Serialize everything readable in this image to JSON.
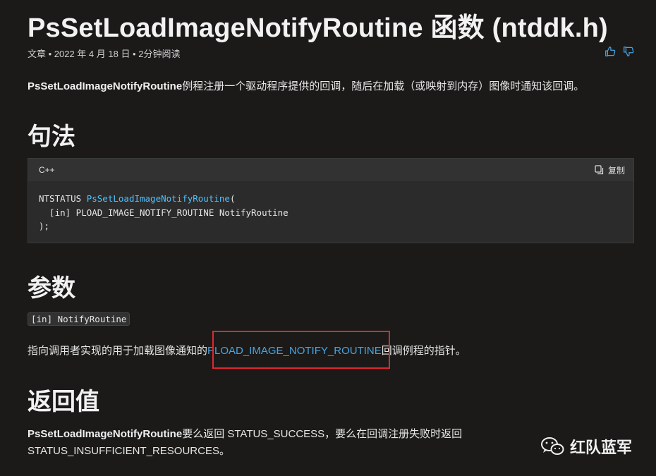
{
  "page": {
    "title": "PsSetLoadImageNotifyRoutine 函数 (ntddk.h)",
    "meta": "文章 • 2022 年 4 月 18 日 • 2分钟阅读",
    "intro_strong": "PsSetLoadImageNotifyRoutine",
    "intro_rest": "例程注册一个驱动程序提供的回调，随后在加载（或映射到内存）图像时通知该回调。"
  },
  "feedback": {
    "like_icon": "thumbs-up-icon",
    "dislike_icon": "thumbs-down-icon"
  },
  "syntax": {
    "heading": "句法",
    "language": "C++",
    "copy_label": "复制",
    "copy_icon": "copy-icon",
    "code": {
      "line1_type": "NTSTATUS ",
      "line1_fn": "PsSetLoadImageNotifyRoutine",
      "line1_paren": "(",
      "line2": "  [in] PLOAD_IMAGE_NOTIFY_ROUTINE NotifyRoutine",
      "line3": ");"
    }
  },
  "parameters": {
    "heading": "参数",
    "param_name": "[in] NotifyRoutine",
    "desc_before": "指向调用者实现的用于加载图像通知的",
    "desc_link": "PLOAD_IMAGE_NOTIFY_ROUTINE",
    "desc_after": "回调例程的指针。"
  },
  "return_value": {
    "heading": "返回值",
    "strong": "PsSetLoadImageNotifyRoutine",
    "text_line1": "要么返回 STATUS_SUCCESS，要么在回调注册失败时返回",
    "text_line2": "STATUS_INSUFFICIENT_RESOURCES。"
  },
  "watermark": {
    "text": "红队蓝军",
    "icon": "wechat-icon"
  },
  "colors": {
    "background": "#1b1a19",
    "link": "#4aa3df",
    "highlight": "#e0262f",
    "code_fn": "#4fc1ff"
  }
}
